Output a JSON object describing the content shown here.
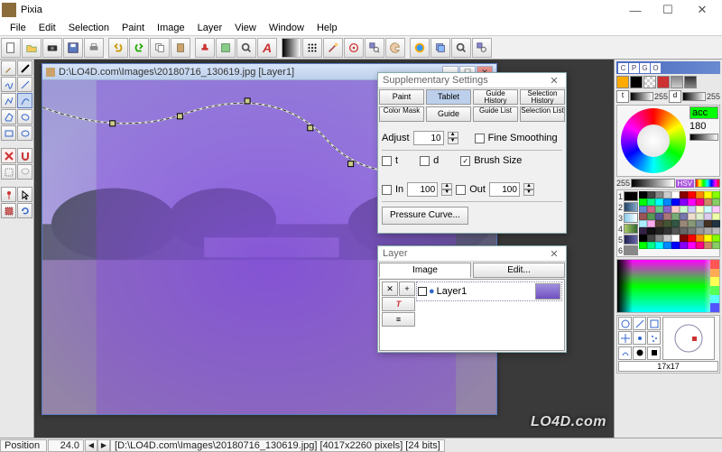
{
  "app": {
    "title": "Pixia"
  },
  "menu": [
    "File",
    "Edit",
    "Selection",
    "Paint",
    "Image",
    "Layer",
    "View",
    "Window",
    "Help"
  ],
  "document": {
    "title": "D:\\LO4D.com\\Images\\20180716_130619.jpg [Layer1]"
  },
  "supp_settings": {
    "title": "Supplementary Settings",
    "tabs_row1": [
      "Paint",
      "Tablet",
      "Guide History",
      "Selection History"
    ],
    "tabs_row2": [
      "Color Mask",
      "Guide",
      "Guide List",
      "Selection List"
    ],
    "active_tab": "Tablet",
    "adjust_label": "Adjust",
    "adjust_value": "10",
    "fine_smoothing_label": "Fine Smoothing",
    "fine_smoothing": false,
    "t_label": "t",
    "t": false,
    "d_label": "d",
    "d": false,
    "brush_size_label": "Brush Size",
    "brush_size": true,
    "in_label": "In",
    "in": false,
    "in_value": "100",
    "out_label": "Out",
    "out": false,
    "out_value": "100",
    "pressure_curve": "Pressure Curve..."
  },
  "layer_panel": {
    "title": "Layer",
    "tabs": [
      "Image",
      "Edit..."
    ],
    "active_tab": "Image",
    "layer_name": "Layer1"
  },
  "right_panel": {
    "header_letters": [
      "C",
      "P",
      "G",
      "O"
    ],
    "slider_value_left": "255",
    "slider_value_right": "255",
    "hue_label_1": "acc",
    "hue_label_2": "180",
    "hue_slider_val": "255",
    "hsv_label": "HSV",
    "palette_nums": [
      "1",
      "2",
      "3",
      "4",
      "5",
      "6"
    ],
    "brush_size": "17x17"
  },
  "statusbar": {
    "position_label": "Position",
    "zoom": "24.0",
    "path": "D:\\LO4D.com\\Images\\20180716_130619.jpg",
    "dims": "4017x2260 pixels",
    "bits": "24 bits"
  },
  "watermark": "LO4D.com"
}
